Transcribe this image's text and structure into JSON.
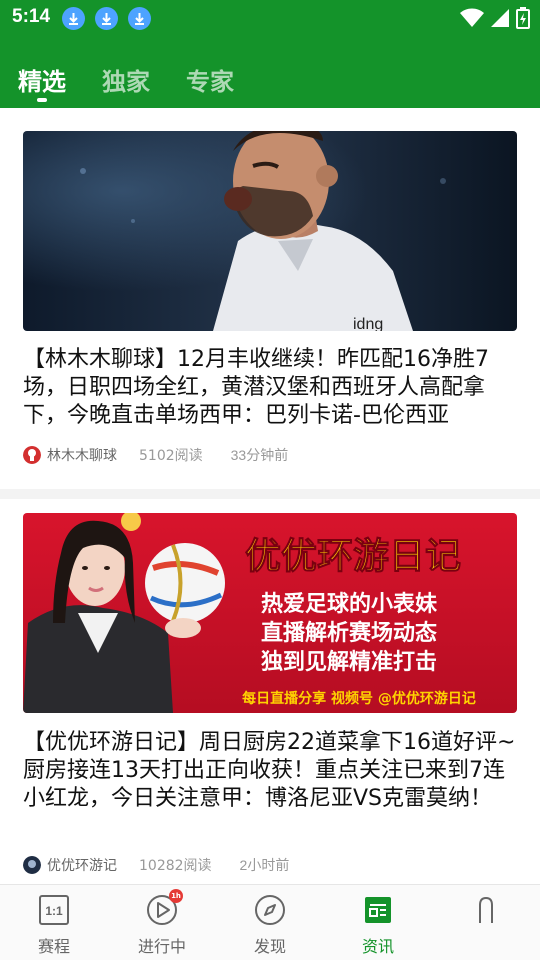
{
  "status": {
    "time": "5:14"
  },
  "tabs": [
    {
      "label": "精选"
    },
    {
      "label": "独家"
    },
    {
      "label": "专家"
    }
  ],
  "feed": [
    {
      "title": "【林木木聊球】12月丰收继续！昨匹配16净胜7场，日职四场全红，黄潜汉堡和西班牙人高配拿下，今晚直击单场西甲：巴列卡诺-巴伦西亚",
      "author": "林木木聊球",
      "reads": "5102阅读",
      "time": "33分钟前"
    },
    {
      "title": "【优优环游日记】周日厨房22道菜拿下16道好评~厨房接连13天打出正向收获！重点关注已来到7连小红龙，今日关注意甲：博洛尼亚VS克雷莫纳！",
      "author": "优优环游记",
      "reads": "10282阅读",
      "time": "2小时前",
      "banner": {
        "heading": "优优环游日记",
        "line1": "热爱足球的小表妹",
        "line2": "直播解析赛场动态",
        "line3": "独到见解精准打击",
        "footer": "每日直播分享 视频号 @优优环游日记"
      }
    }
  ],
  "bottomnav": [
    {
      "label": "赛程",
      "icon_text": "1:1"
    },
    {
      "label": "进行中",
      "badge": "1h"
    },
    {
      "label": "发现"
    },
    {
      "label": "资讯"
    },
    {
      "label": ""
    }
  ],
  "colors": {
    "brand": "#14932a",
    "banner_red": "#c8102e",
    "banner_yellow": "#ffd400"
  }
}
